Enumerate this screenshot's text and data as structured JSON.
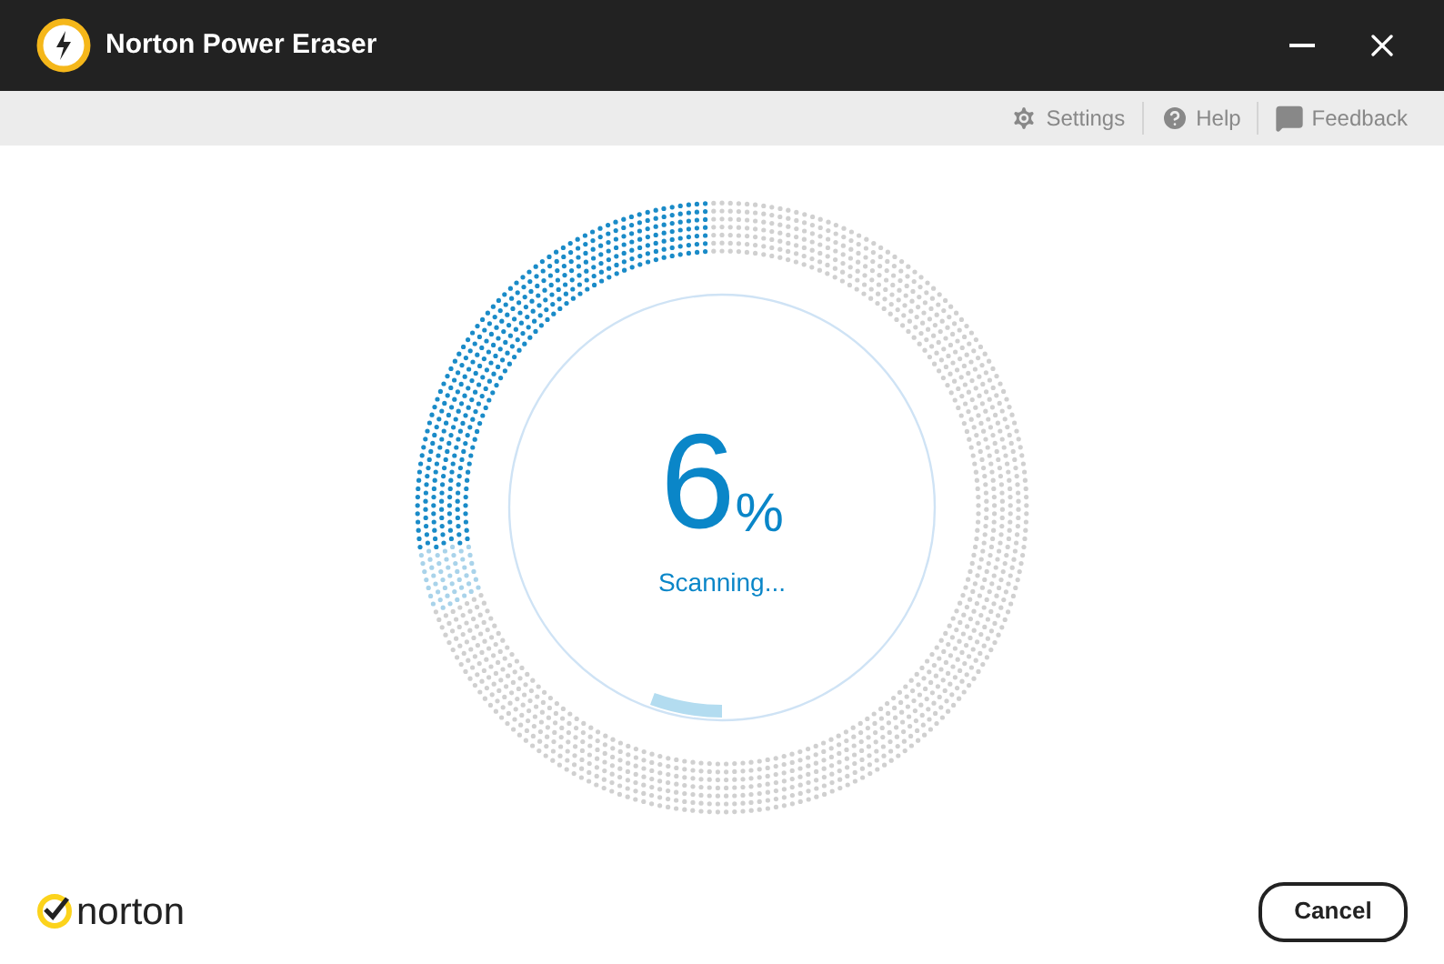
{
  "window": {
    "title": "Norton Power Eraser"
  },
  "toolbar": [
    {
      "kind": "settings",
      "label": "Settings"
    },
    {
      "kind": "help",
      "label": "Help"
    },
    {
      "kind": "feedback",
      "label": "Feedback"
    }
  ],
  "progress": {
    "percent": "6",
    "unit": "%",
    "status": "Scanning..."
  },
  "footer": {
    "logo": "norton",
    "button": "Cancel"
  }
}
